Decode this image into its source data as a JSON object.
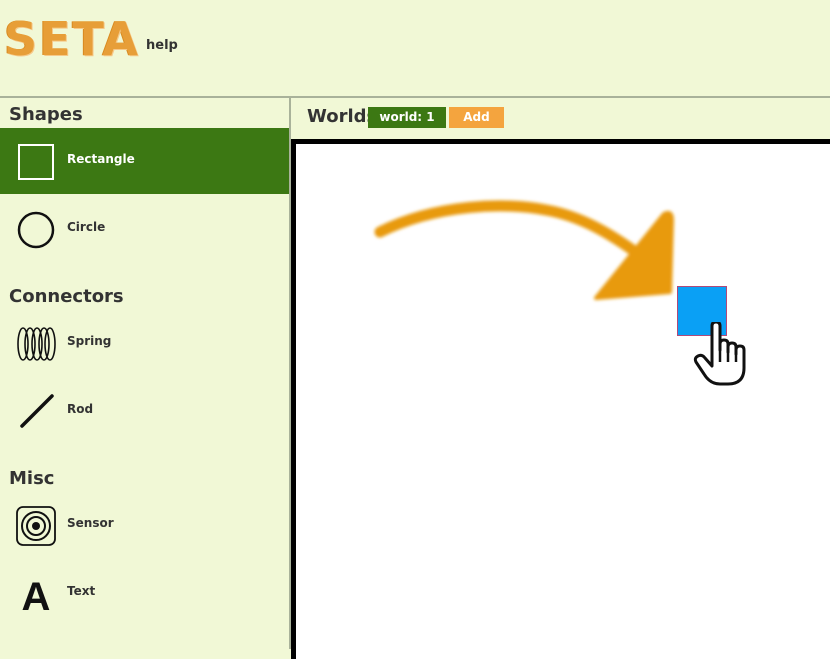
{
  "header": {
    "logo_text": "SETA",
    "help_label": "help"
  },
  "sidebar": {
    "sections": [
      {
        "title": "Shapes",
        "items": [
          {
            "label": "Rectangle",
            "icon": "rectangle-icon",
            "selected": true
          },
          {
            "label": "Circle",
            "icon": "circle-icon",
            "selected": false
          }
        ]
      },
      {
        "title": "Connectors",
        "items": [
          {
            "label": "Spring",
            "icon": "spring-icon",
            "selected": false
          },
          {
            "label": "Rod",
            "icon": "rod-icon",
            "selected": false
          }
        ]
      },
      {
        "title": "Misc",
        "items": [
          {
            "label": "Sensor",
            "icon": "sensor-icon",
            "selected": false
          },
          {
            "label": "Text",
            "icon": "text-icon",
            "selected": false
          }
        ]
      }
    ]
  },
  "worlds": {
    "label": "Worlds",
    "tabs": [
      {
        "label": "world: 1",
        "active": true
      }
    ],
    "add_label": "Add"
  },
  "canvas": {
    "objects": [
      {
        "type": "rectangle",
        "fill": "#0aa0f5",
        "stroke": "#b04a7a"
      }
    ]
  },
  "colors": {
    "accent_green": "#3c7813",
    "accent_orange": "#f4a43e",
    "background": "#f1f8d6",
    "logo_orange": "#e79e38"
  }
}
